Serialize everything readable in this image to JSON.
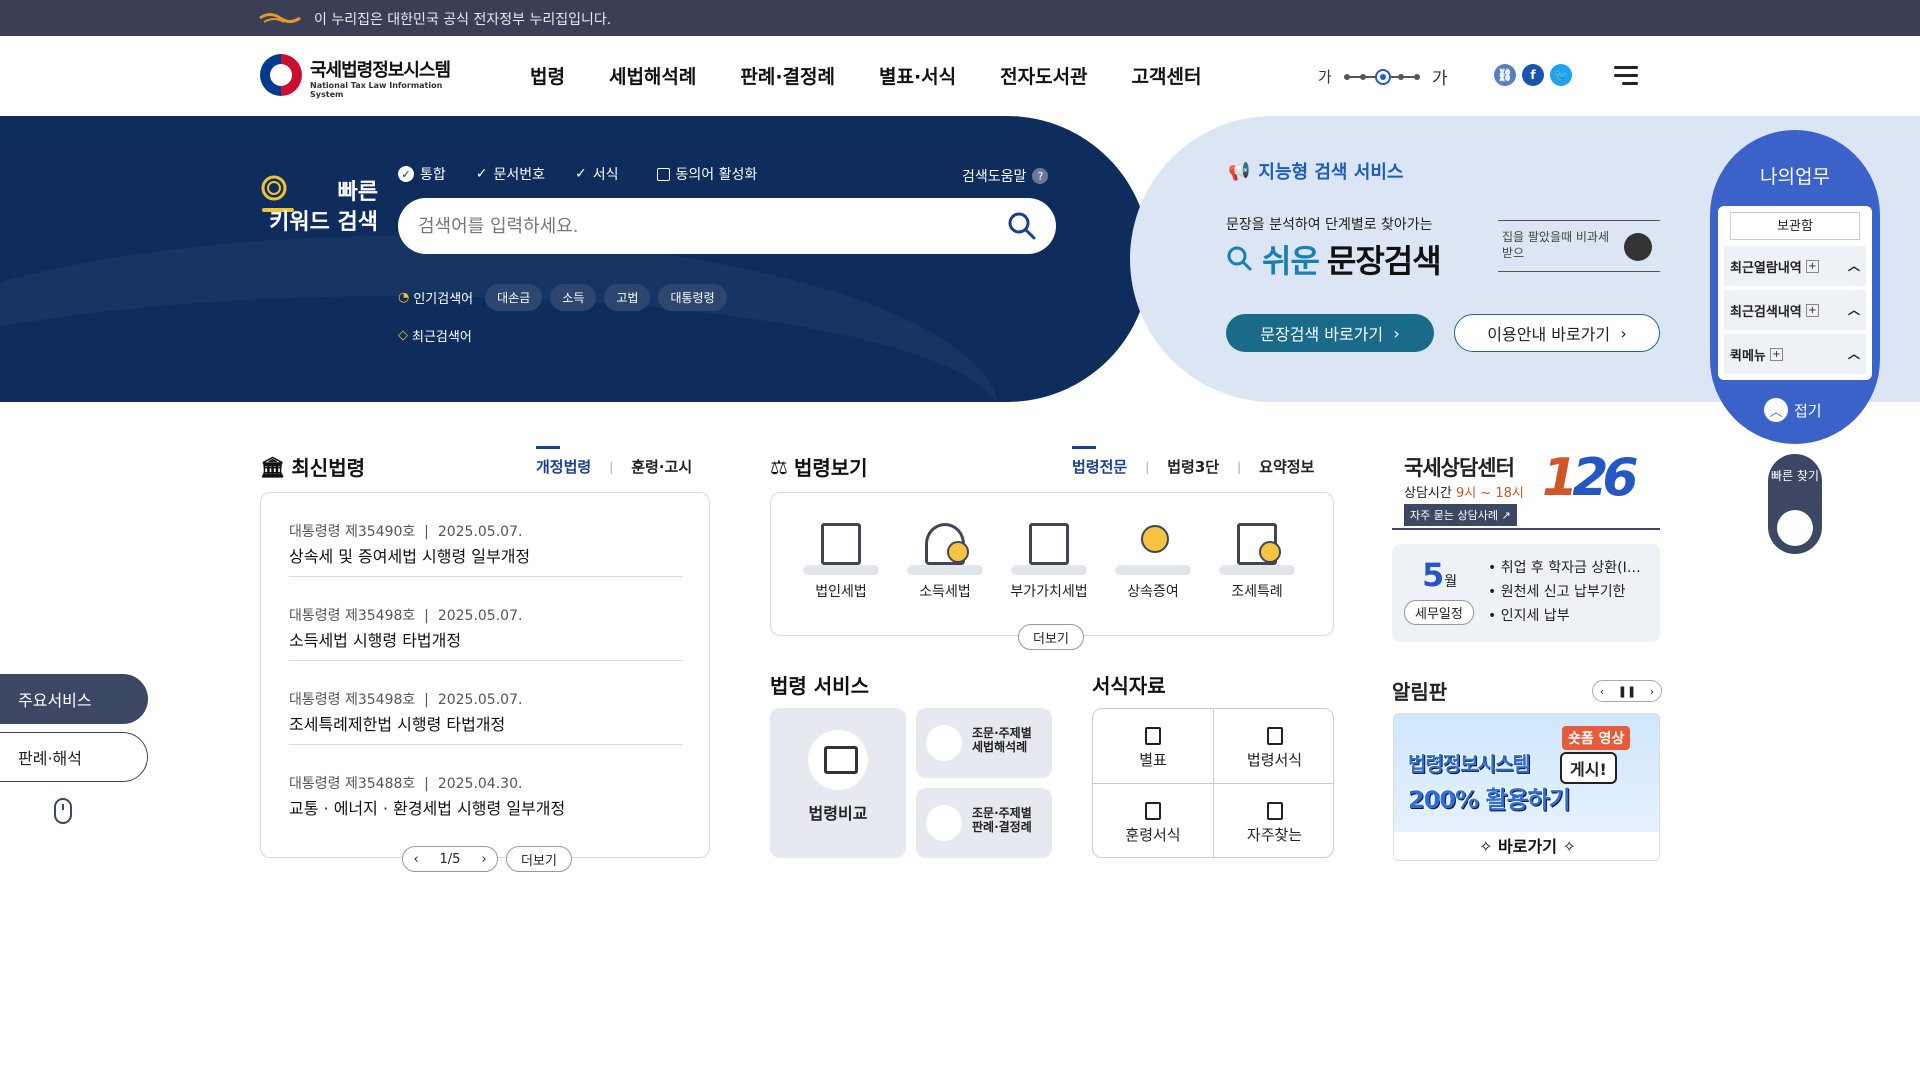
{
  "gov_bar": {
    "text": "이 누리집은 대한민국 공식 전자정부 누리집입니다."
  },
  "brand": {
    "name": "국세법령정보시스템",
    "english": "National Tax Law Information System"
  },
  "gnb": [
    "법령",
    "세법해석례",
    "판례·결정례",
    "별표·서식",
    "전자도서관",
    "고객센터"
  ],
  "font_control": {
    "small": "가",
    "large": "가"
  },
  "social": {
    "link": "link-icon",
    "facebook": "f",
    "twitter": "t"
  },
  "quick_search": {
    "title_line1": "빠른",
    "title_line2": "키워드 검색",
    "options": [
      "통합",
      "문서번호",
      "서식"
    ],
    "synonym": "동의어 활성화",
    "help": "검색도움말",
    "placeholder": "검색어를 입력하세요.",
    "popular_label": "인기검색어",
    "popular": [
      "대손금",
      "소득",
      "고법",
      "대통령령"
    ],
    "recent_label": "최근검색어"
  },
  "ai_search": {
    "title": "지능형 검색 서비스",
    "sub": "문장을 분석하여 단계별로 찾아가는",
    "big_easy": "쉬운",
    "big_rest": "문장검색",
    "sample": "집을 팔았을때 비과세 받으",
    "btn_go": "문장검색 바로가기",
    "btn_guide": "이용안내 바로가기"
  },
  "my_work": {
    "title": "나의업무",
    "storage": "보관함",
    "rows": [
      "최근열람내역",
      "최근검색내역",
      "퀵메뉴"
    ],
    "fold": "접기"
  },
  "quick_find": {
    "label": "빠른 찾기"
  },
  "side_tabs": [
    "주요서비스",
    "판례·해석"
  ],
  "latest": {
    "title": "최신법령",
    "tabs": [
      "개정법령",
      "훈령·고시"
    ],
    "items": [
      {
        "meta_no": "대통령령 제35490호",
        "date": "2025.05.07.",
        "title": "상속세 및 증여세법 시행령 일부개정"
      },
      {
        "meta_no": "대통령령 제35498호",
        "date": "2025.05.07.",
        "title": "소득세법 시행령 타법개정"
      },
      {
        "meta_no": "대통령령 제35498호",
        "date": "2025.05.07.",
        "title": "조세특례제한법 시행령 타법개정"
      },
      {
        "meta_no": "대통령령 제35488호",
        "date": "2025.04.30.",
        "title": "교통 · 에너지 · 환경세법 시행령 일부개정"
      }
    ],
    "page": "1/5",
    "more": "더보기"
  },
  "law_view": {
    "title": "법령보기",
    "tabs": [
      "법령전문",
      "법령3단",
      "요약정보"
    ],
    "items": [
      "법인세법",
      "소득세법",
      "부가가치세법",
      "상속증여",
      "조세특례"
    ],
    "more": "더보기"
  },
  "law_service": {
    "title": "법령 서비스",
    "big": "법령비교",
    "small": [
      {
        "line1": "조문·주제별",
        "line2": "세법해석례"
      },
      {
        "line1": "조문·주제별",
        "line2": "판례·결정례"
      }
    ]
  },
  "forms": {
    "title": "서식자료",
    "cells": [
      "별표",
      "법령서식",
      "훈령서식",
      "자주찾는"
    ]
  },
  "tax_center": {
    "title": "국세상담센터",
    "hours_label": "상담시간",
    "hours": "9시 ~ 18시",
    "faq": "자주 묻는 상담사례",
    "number_1": "1",
    "number_rest": "26"
  },
  "schedule": {
    "month": "5",
    "month_unit": "월",
    "label": "세무일정",
    "items": [
      "취업 후 학자금 상환(I…",
      "원천세 신고 납부기한",
      "인지세 납부"
    ]
  },
  "notice": {
    "title": "알림판",
    "banner_line1": "법령정보시스템",
    "banner_line2": "200% 활용하기",
    "banner_tag": "숏폼 영상",
    "banner_bubble": "게시!",
    "banner_cta": "✧ 바로가기 ✧"
  },
  "colors": {
    "navy": "#0e2d5c",
    "accent_blue": "#1b3f8f",
    "teal": "#1a6b8a",
    "my_work_blue": "#3a62c9",
    "orange": "#d2552a"
  }
}
